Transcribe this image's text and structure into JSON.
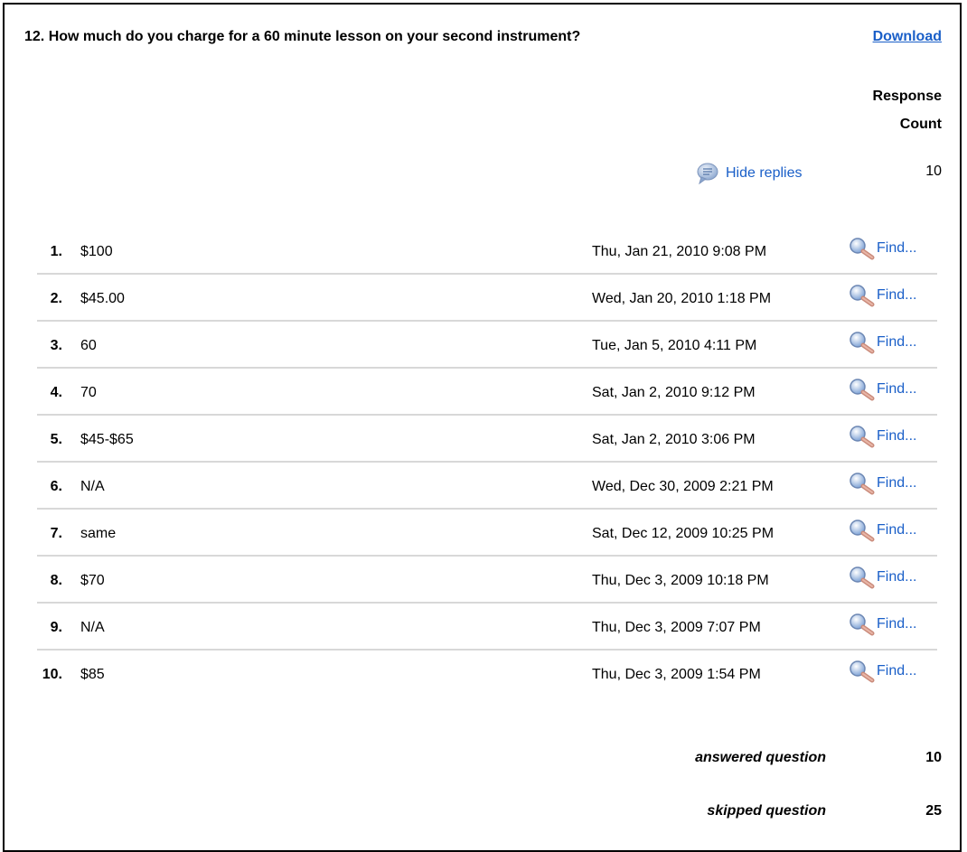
{
  "question": {
    "title": "12. How much do you charge for a 60 minute lesson on your second instrument?",
    "download_label": "Download"
  },
  "columns": {
    "response": "Response",
    "count": "Count"
  },
  "replies": {
    "toggle_label": "Hide replies",
    "response_count": "10",
    "icon": "speech-bubble-icon"
  },
  "responses": [
    {
      "num": "1.",
      "answer": "$100",
      "date": "Thu, Jan 21, 2010 9:08 PM",
      "find": "Find..."
    },
    {
      "num": "2.",
      "answer": "$45.00",
      "date": "Wed, Jan 20, 2010 1:18 PM",
      "find": "Find..."
    },
    {
      "num": "3.",
      "answer": "60",
      "date": "Tue, Jan 5, 2010 4:11 PM",
      "find": "Find..."
    },
    {
      "num": "4.",
      "answer": "70",
      "date": "Sat, Jan 2, 2010 9:12 PM",
      "find": "Find..."
    },
    {
      "num": "5.",
      "answer": "$45-$65",
      "date": "Sat, Jan 2, 2010 3:06 PM",
      "find": "Find..."
    },
    {
      "num": "6.",
      "answer": "N/A",
      "date": "Wed, Dec 30, 2009 2:21 PM",
      "find": "Find..."
    },
    {
      "num": "7.",
      "answer": "same",
      "date": "Sat, Dec 12, 2009 10:25 PM",
      "find": "Find..."
    },
    {
      "num": "8.",
      "answer": "$70",
      "date": "Thu, Dec 3, 2009 10:18 PM",
      "find": "Find..."
    },
    {
      "num": "9.",
      "answer": "N/A",
      "date": "Thu, Dec 3, 2009 7:07 PM",
      "find": "Find..."
    },
    {
      "num": "10.",
      "answer": "$85",
      "date": "Thu, Dec 3, 2009 1:54 PM",
      "find": "Find..."
    }
  ],
  "summary": {
    "answered_label": "answered question",
    "answered_value": "10",
    "skipped_label": "skipped question",
    "skipped_value": "25"
  },
  "colors": {
    "link": "#1a5fc8",
    "divider": "#d8d8d8"
  }
}
